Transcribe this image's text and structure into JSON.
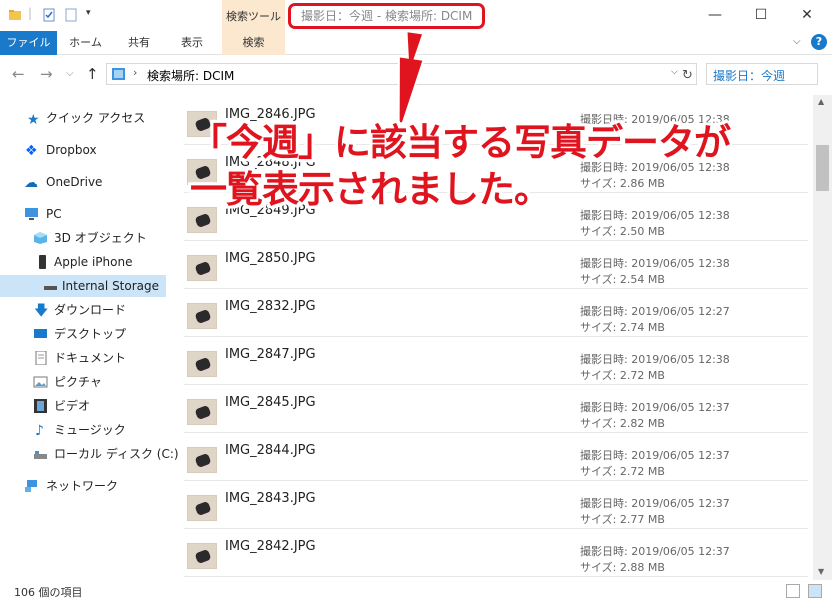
{
  "window": {
    "title": "撮影日：今週 - 検索場所: DCIM",
    "context_tab_header": "検索ツール",
    "controls": {
      "minimize": "—",
      "maximize": "☐",
      "close": "✕"
    }
  },
  "ribbon": {
    "tabs": [
      "ファイル",
      "ホーム",
      "共有",
      "表示",
      "検索"
    ],
    "expand": "⌵",
    "help": "?"
  },
  "address": {
    "separator": "›",
    "path": "検索場所: DCIM",
    "dropdown": "⌵",
    "refresh": "↻",
    "back": "←",
    "forward": "→",
    "recent": "⌵",
    "up": "↑"
  },
  "search": {
    "value": "撮影日：今週"
  },
  "nav": {
    "quick_access": "クイック アクセス",
    "dropbox": "Dropbox",
    "onedrive": "OneDrive",
    "pc": "PC",
    "objects3d": "3D オブジェクト",
    "iphone": "Apple iPhone",
    "internal_storage": "Internal Storage",
    "downloads": "ダウンロード",
    "desktop": "デスクトップ",
    "documents": "ドキュメント",
    "pictures": "ピクチャ",
    "videos": "ビデオ",
    "music": "ミュージック",
    "local_disk": "ローカル ディスク (C:)",
    "network": "ネットワーク"
  },
  "files": [
    {
      "name": "IMG_2846.JPG",
      "date": "撮影日時: 2019/06/05 12:38",
      "size": ""
    },
    {
      "name": "IMG_2848.JPG",
      "date": "撮影日時: 2019/06/05 12:38",
      "size": "サイズ: 2.86 MB"
    },
    {
      "name": "IMG_2849.JPG",
      "date": "撮影日時: 2019/06/05 12:38",
      "size": "サイズ: 2.50 MB"
    },
    {
      "name": "IMG_2850.JPG",
      "date": "撮影日時: 2019/06/05 12:38",
      "size": "サイズ: 2.54 MB"
    },
    {
      "name": "IMG_2832.JPG",
      "date": "撮影日時: 2019/06/05 12:27",
      "size": "サイズ: 2.74 MB"
    },
    {
      "name": "IMG_2847.JPG",
      "date": "撮影日時: 2019/06/05 12:38",
      "size": "サイズ: 2.72 MB"
    },
    {
      "name": "IMG_2845.JPG",
      "date": "撮影日時: 2019/06/05 12:37",
      "size": "サイズ: 2.82 MB"
    },
    {
      "name": "IMG_2844.JPG",
      "date": "撮影日時: 2019/06/05 12:37",
      "size": "サイズ: 2.72 MB"
    },
    {
      "name": "IMG_2843.JPG",
      "date": "撮影日時: 2019/06/05 12:37",
      "size": "サイズ: 2.77 MB"
    },
    {
      "name": "IMG_2842.JPG",
      "date": "撮影日時: 2019/06/05 12:37",
      "size": "サイズ: 2.88 MB"
    }
  ],
  "status": {
    "count": "106 個の項目"
  },
  "annotation": {
    "line1": "「今週」に該当する写真データが",
    "line2": "一覧表示されました。"
  },
  "colors": {
    "accent": "#1979ca",
    "context_tab": "#fbe8cf",
    "annotation": "#e0141e",
    "selected": "#cce4f7"
  }
}
